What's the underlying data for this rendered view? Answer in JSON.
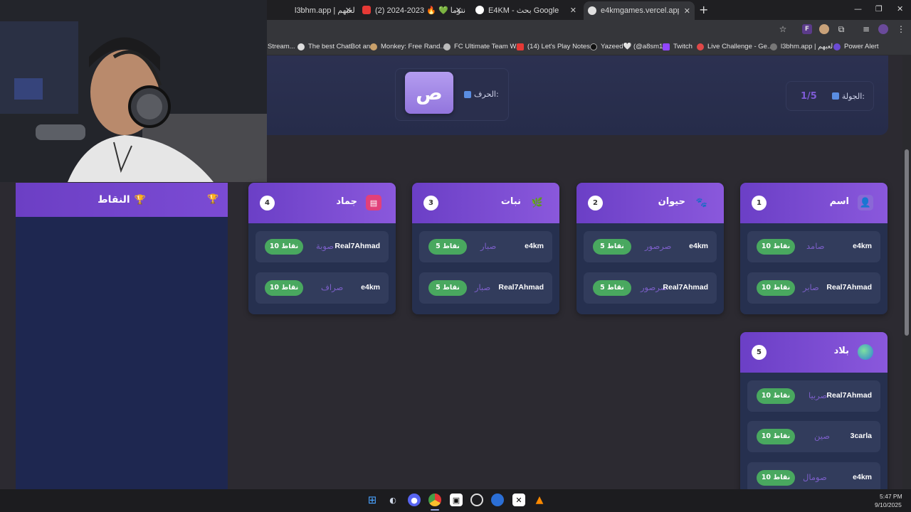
{
  "browser": {
    "tabs": [
      {
        "title": "l3bhm.app | لعبهم",
        "active": false
      },
      {
        "title": "(2) شكون انتوما 💚 🔥 2023-2024",
        "active": false
      },
      {
        "title": "E4KM - بحث Google",
        "active": false
      },
      {
        "title": "e4kmgames.vercel.app/games/",
        "active": true
      }
    ],
    "bookmarks": [
      "Stream...",
      "The best ChatBot an...",
      "Monkey: Free Rand...",
      "FC Ultimate Team W...",
      "(14) Let's Play Notes...",
      "Yazeed🤍 (@a8sm1...",
      "Twitch",
      "Live Challenge - Ge...",
      "l3bhm.app | لعبهم",
      "Power Alert"
    ]
  },
  "game": {
    "round_label": "الجولة:",
    "round_value": "1/5",
    "letter_label": "الحرف:",
    "letter": "ص",
    "scores_title": "النقاط",
    "categories": [
      {
        "number": "1",
        "title": "اسم",
        "icon": "person-icon",
        "entries": [
          {
            "player": "e4km",
            "word": "صامد",
            "points": "10 نقاط"
          },
          {
            "player": "Real7Ahmad",
            "word": "صابر",
            "points": "10 نقاط"
          }
        ]
      },
      {
        "number": "2",
        "title": "حيوان",
        "icon": "paw-icon",
        "entries": [
          {
            "player": "e4km",
            "word": "صرصور",
            "points": "5 نقاط"
          },
          {
            "player": "Real7Ahmad",
            "word": "صرصور",
            "points": "5 نقاط"
          }
        ]
      },
      {
        "number": "3",
        "title": "نبات",
        "icon": "leaf-icon",
        "entries": [
          {
            "player": "e4km",
            "word": "صبار",
            "points": "5 نقاط"
          },
          {
            "player": "Real7Ahmad",
            "word": "صبار",
            "points": "5 نقاط"
          }
        ]
      },
      {
        "number": "4",
        "title": "جماد",
        "icon": "toolbox-icon",
        "entries": [
          {
            "player": "Real7Ahmad",
            "word": "صوبة",
            "points": "10 نقاط"
          },
          {
            "player": "e4km",
            "word": "صراف",
            "points": "10 نقاط"
          }
        ]
      },
      {
        "number": "5",
        "title": "بلاد",
        "icon": "globe-icon",
        "entries": [
          {
            "player": "Real7Ahmad",
            "word": "صربيا",
            "points": "10 نقاط"
          },
          {
            "player": "3carla",
            "word": "صين",
            "points": "10 نقاط"
          },
          {
            "player": "e4km",
            "word": "صومال",
            "points": "10 نقاط"
          }
        ]
      }
    ]
  },
  "taskbar": {
    "time": "5:47 PM",
    "date": "9/10/2025"
  },
  "colors": {
    "accent_purple": "#7b4bd4",
    "points_green": "#49a85f",
    "word_purple": "#7c5fc9"
  }
}
